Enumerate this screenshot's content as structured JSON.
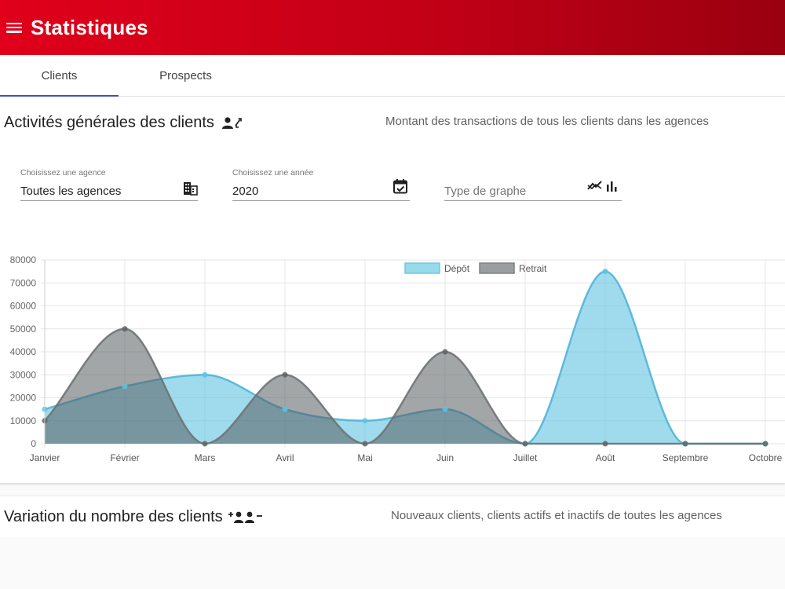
{
  "header": {
    "title": "Statistiques"
  },
  "tabs": [
    {
      "label": "Clients"
    },
    {
      "label": "Prospects"
    }
  ],
  "section1": {
    "title": "Activités générales des clients",
    "description": "Montant des transactions de tous les clients dans les agences",
    "agency": {
      "label": "Choisissez une agence",
      "value": "Toutes les agences"
    },
    "year": {
      "label": "Choisissez une année",
      "value": "2020"
    },
    "graph_type": {
      "placeholder": "Type de graphe"
    }
  },
  "section2": {
    "title": "Variation du nombre des clients",
    "description": "Nouveaux clients, clients actifs et inactifs de toutes les agences"
  },
  "colors": {
    "depot": "#8fd3e8",
    "retrait": "#8e9496",
    "header": "#d0021b",
    "tab_indicator": "#3f51b5"
  },
  "chart_data": {
    "type": "area",
    "categories": [
      "Janvier",
      "Février",
      "Mars",
      "Avril",
      "Mai",
      "Juin",
      "Juillet",
      "Août",
      "Septembre",
      "Octobre"
    ],
    "series": [
      {
        "name": "Dépôt",
        "values": [
          15000,
          25000,
          30000,
          15000,
          10000,
          15000,
          0,
          75000,
          0,
          0
        ]
      },
      {
        "name": "Retrait",
        "values": [
          10000,
          50000,
          0,
          30000,
          0,
          40000,
          0,
          0,
          0,
          0
        ]
      }
    ],
    "y_ticks": [
      "0",
      "10000",
      "20000",
      "30000",
      "40000",
      "50000",
      "60000",
      "70000",
      "80000"
    ],
    "ylim": [
      0,
      80000
    ],
    "grid": true,
    "legend": "top-center"
  }
}
